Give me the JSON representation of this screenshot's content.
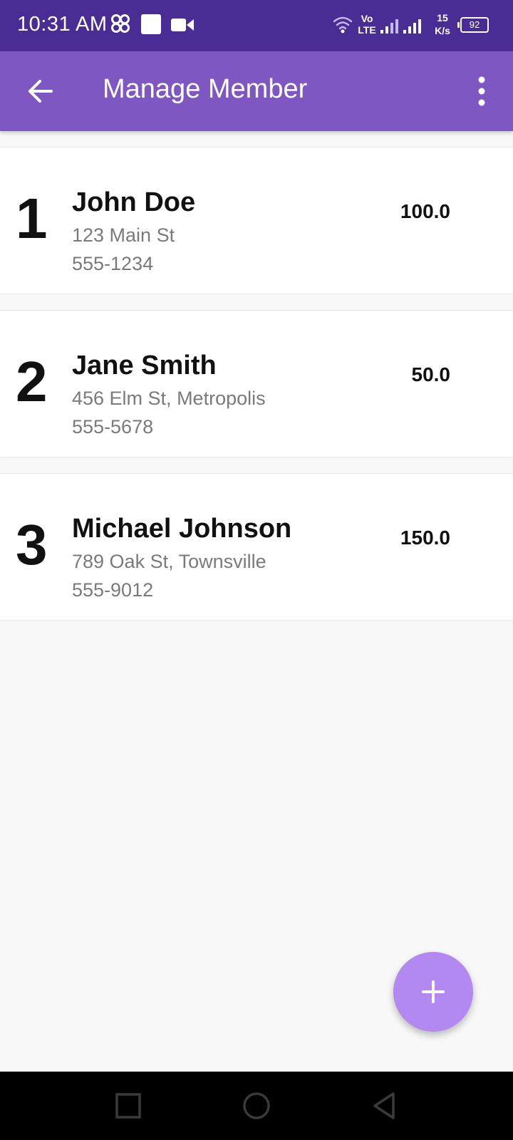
{
  "status_bar": {
    "time": "10:31 AM",
    "net_speed_value": "15",
    "net_speed_unit": "K/s",
    "battery": "92",
    "network_label_top": "Vo",
    "network_label_bottom": "LTE",
    "icons": [
      "cluster-icon",
      "square-notification-icon",
      "video-camera-icon",
      "wifi-icon",
      "signal-icon",
      "battery-icon"
    ]
  },
  "app_bar": {
    "title": "Manage Member",
    "back_icon": "arrow-back-icon",
    "menu_icon": "more-vertical-icon"
  },
  "members": [
    {
      "index": "1",
      "name": "John Doe",
      "address": "123 Main St",
      "phone": "555-1234",
      "amount": "100.0"
    },
    {
      "index": "2",
      "name": "Jane Smith",
      "address": "456 Elm St, Metropolis",
      "phone": "555-5678",
      "amount": "50.0"
    },
    {
      "index": "3",
      "name": "Michael Johnson",
      "address": "789 Oak St, Townsville",
      "phone": "555-9012",
      "amount": "150.0"
    }
  ],
  "fab": {
    "icon": "plus-icon"
  },
  "nav_bar": {
    "icons": [
      "recent-apps-icon",
      "home-icon",
      "back-triangle-icon"
    ]
  },
  "colors": {
    "status_bar": "#4a2d94",
    "app_bar": "#7e57c2",
    "fab": "#b388f0",
    "background": "#f8f8f8"
  }
}
